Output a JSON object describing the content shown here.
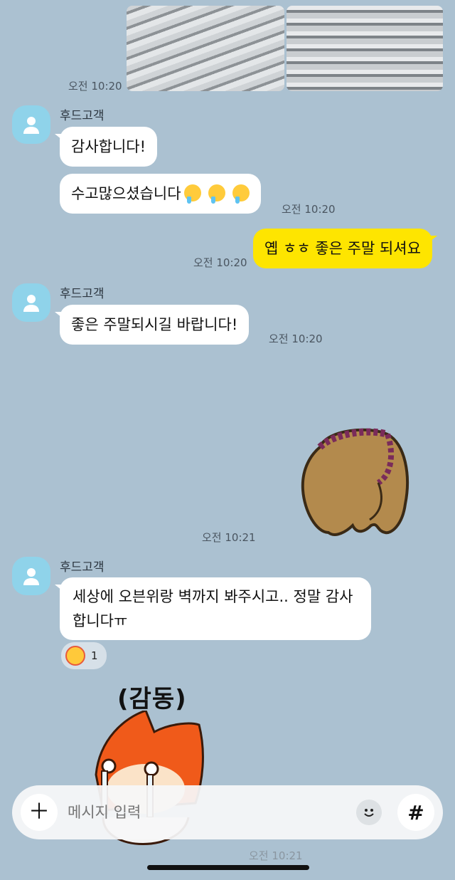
{
  "chat": {
    "top_photos_time": "오전 10:20",
    "sender_name": "후드고객",
    "msg1": "감사합니다!",
    "msg2": "수고많으셨습니다",
    "msg2_time": "오전 10:20",
    "my_msg": "옙 ㅎㅎ 좋은 주말 되셔요",
    "my_msg_time": "오전 10:20",
    "sender_name2": "후드고객",
    "msg3": "좋은 주말되시길 바랍니다!",
    "msg3_time": "오전 10:20",
    "sticker_time": "오전 10:21",
    "sender_name3": "후드고객",
    "msg4": "세상에 오븐위랑 벽까지 봐주시고.. 정말 감사합니다ㅠ",
    "reaction_count": "1",
    "sticker2_caption": "(감동)",
    "bottom_time": "오전 10:21"
  },
  "composer": {
    "placeholder": "메시지 입력",
    "plus_icon": "plus-icon",
    "emoji_icon": "emoji-icon",
    "hash_icon": "hash-icon"
  },
  "colors": {
    "background": "#abc1d1",
    "my_bubble": "#fee500",
    "their_bubble": "#ffffff",
    "avatar": "#8fd3ea"
  }
}
